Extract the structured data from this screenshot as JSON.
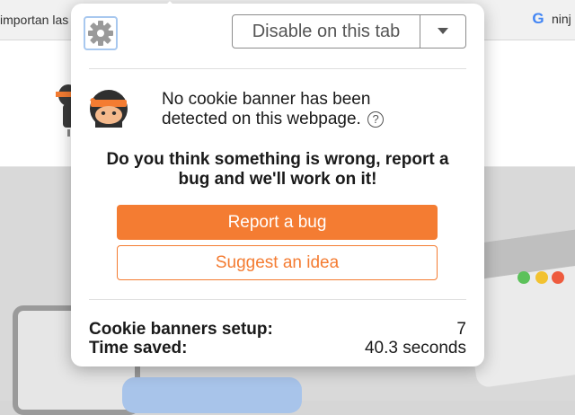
{
  "browser": {
    "tab_left_title": "importan las",
    "tab_right_title": "ninj",
    "tab_right_favicon": "google-g-icon"
  },
  "popup": {
    "settings_icon": "gear-icon",
    "disable_button_label": "Disable on this tab",
    "dropdown_icon": "caret-down-icon",
    "status_message": "No cookie banner has been detected on this webpage.",
    "help_icon_glyph": "?",
    "report_prompt": "Do you think something is wrong, report a bug and we'll work on it!",
    "report_button_label": "Report a bug",
    "suggest_button_label": "Suggest an idea",
    "stats": {
      "banners_label": "Cookie banners setup:",
      "banners_value": "7",
      "time_label": "Time saved:",
      "time_value": "40.3 seconds"
    }
  },
  "colors": {
    "accent_orange": "#f47c32",
    "settings_border": "#a8c8ef"
  }
}
